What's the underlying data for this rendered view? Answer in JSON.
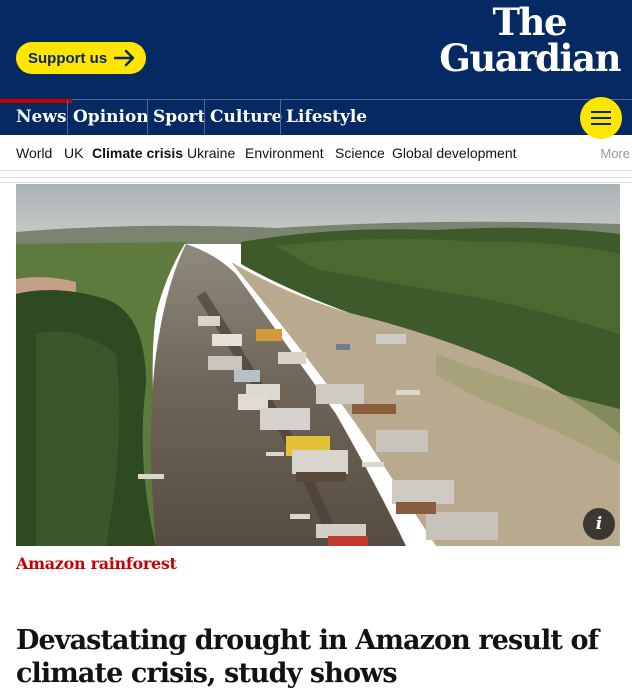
{
  "masthead": {
    "support_label": "Support us",
    "logo_line1": "The",
    "logo_line2": "Guardian",
    "bg_color": "#052962",
    "accent_color": "#ffe500"
  },
  "pillars": [
    {
      "label": "News",
      "active": true
    },
    {
      "label": "Opinion",
      "active": false
    },
    {
      "label": "Sport",
      "active": false
    },
    {
      "label": "Culture",
      "active": false
    },
    {
      "label": "Lifestyle",
      "active": false
    }
  ],
  "menu_icon": "hamburger-icon",
  "subnav": {
    "items": [
      "World",
      "UK",
      "Climate crisis",
      "Ukraine",
      "Environment",
      "Science",
      "Global development"
    ],
    "current": "Climate crisis",
    "more_label": "More"
  },
  "article": {
    "kicker": "Amazon rainforest",
    "kicker_color": "#c70000",
    "headline": "Devastating drought in Amazon result of climate crisis, study shows",
    "info_label": "i"
  }
}
